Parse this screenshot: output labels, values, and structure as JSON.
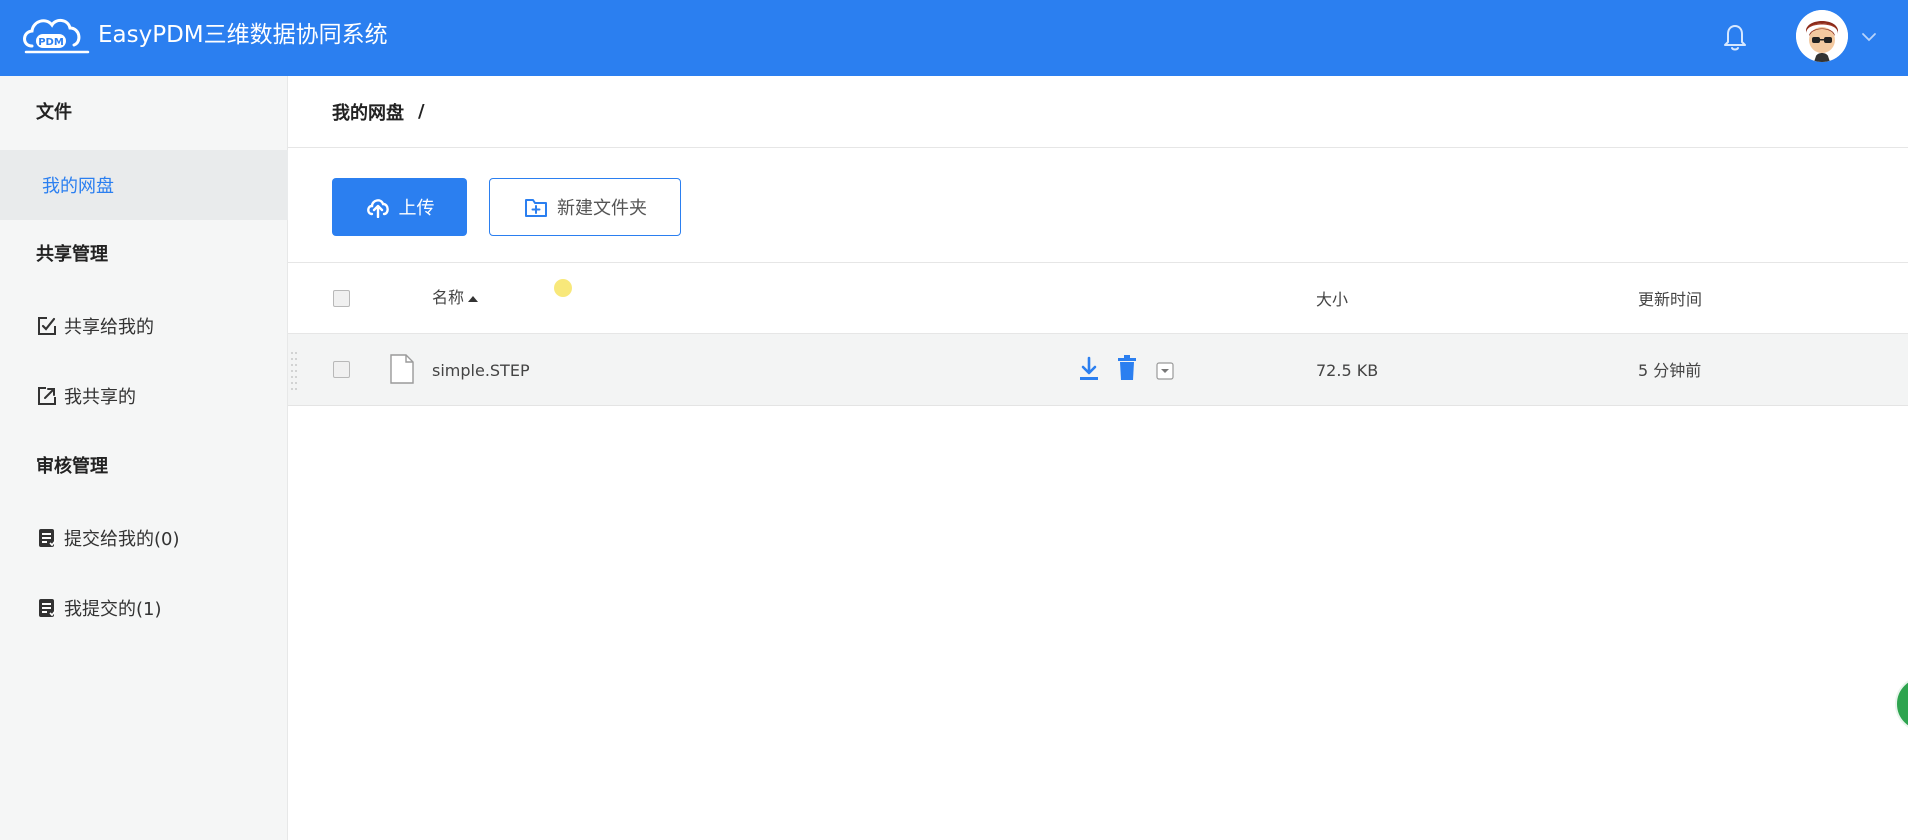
{
  "header": {
    "logo_text": "PDM",
    "title": "EasyPDM三维数据协同系统",
    "bell_icon": "bell-icon",
    "avatar_icon": "avatar-icon",
    "caret_icon": "chevron-down-icon"
  },
  "sidebar": {
    "sections": [
      {
        "title": "文件",
        "items": [
          {
            "label": "我的网盘",
            "icon": "",
            "active": true
          }
        ]
      },
      {
        "title": "共享管理",
        "items": [
          {
            "label": "共享给我的",
            "icon": "shared-to-me-icon"
          },
          {
            "label": "我共享的",
            "icon": "my-shares-icon"
          }
        ]
      },
      {
        "title": "审核管理",
        "items": [
          {
            "label": "提交给我的(0)",
            "icon": "review-doc-icon"
          },
          {
            "label": "我提交的(1)",
            "icon": "review-doc-icon"
          }
        ]
      }
    ]
  },
  "breadcrumb": {
    "path": "我的网盘",
    "separator": "/"
  },
  "toolbar": {
    "upload_label": "上传",
    "new_folder_label": "新建文件夹"
  },
  "table": {
    "columns": {
      "name": "名称",
      "size": "大小",
      "updated": "更新时间"
    },
    "rows": [
      {
        "name": "simple.STEP",
        "size": "72.5 KB",
        "updated": "5 分钟前"
      }
    ]
  },
  "colors": {
    "primary": "#2b7ff0",
    "sidebar_bg": "#f5f6f6",
    "row_bg": "#f3f4f4"
  }
}
